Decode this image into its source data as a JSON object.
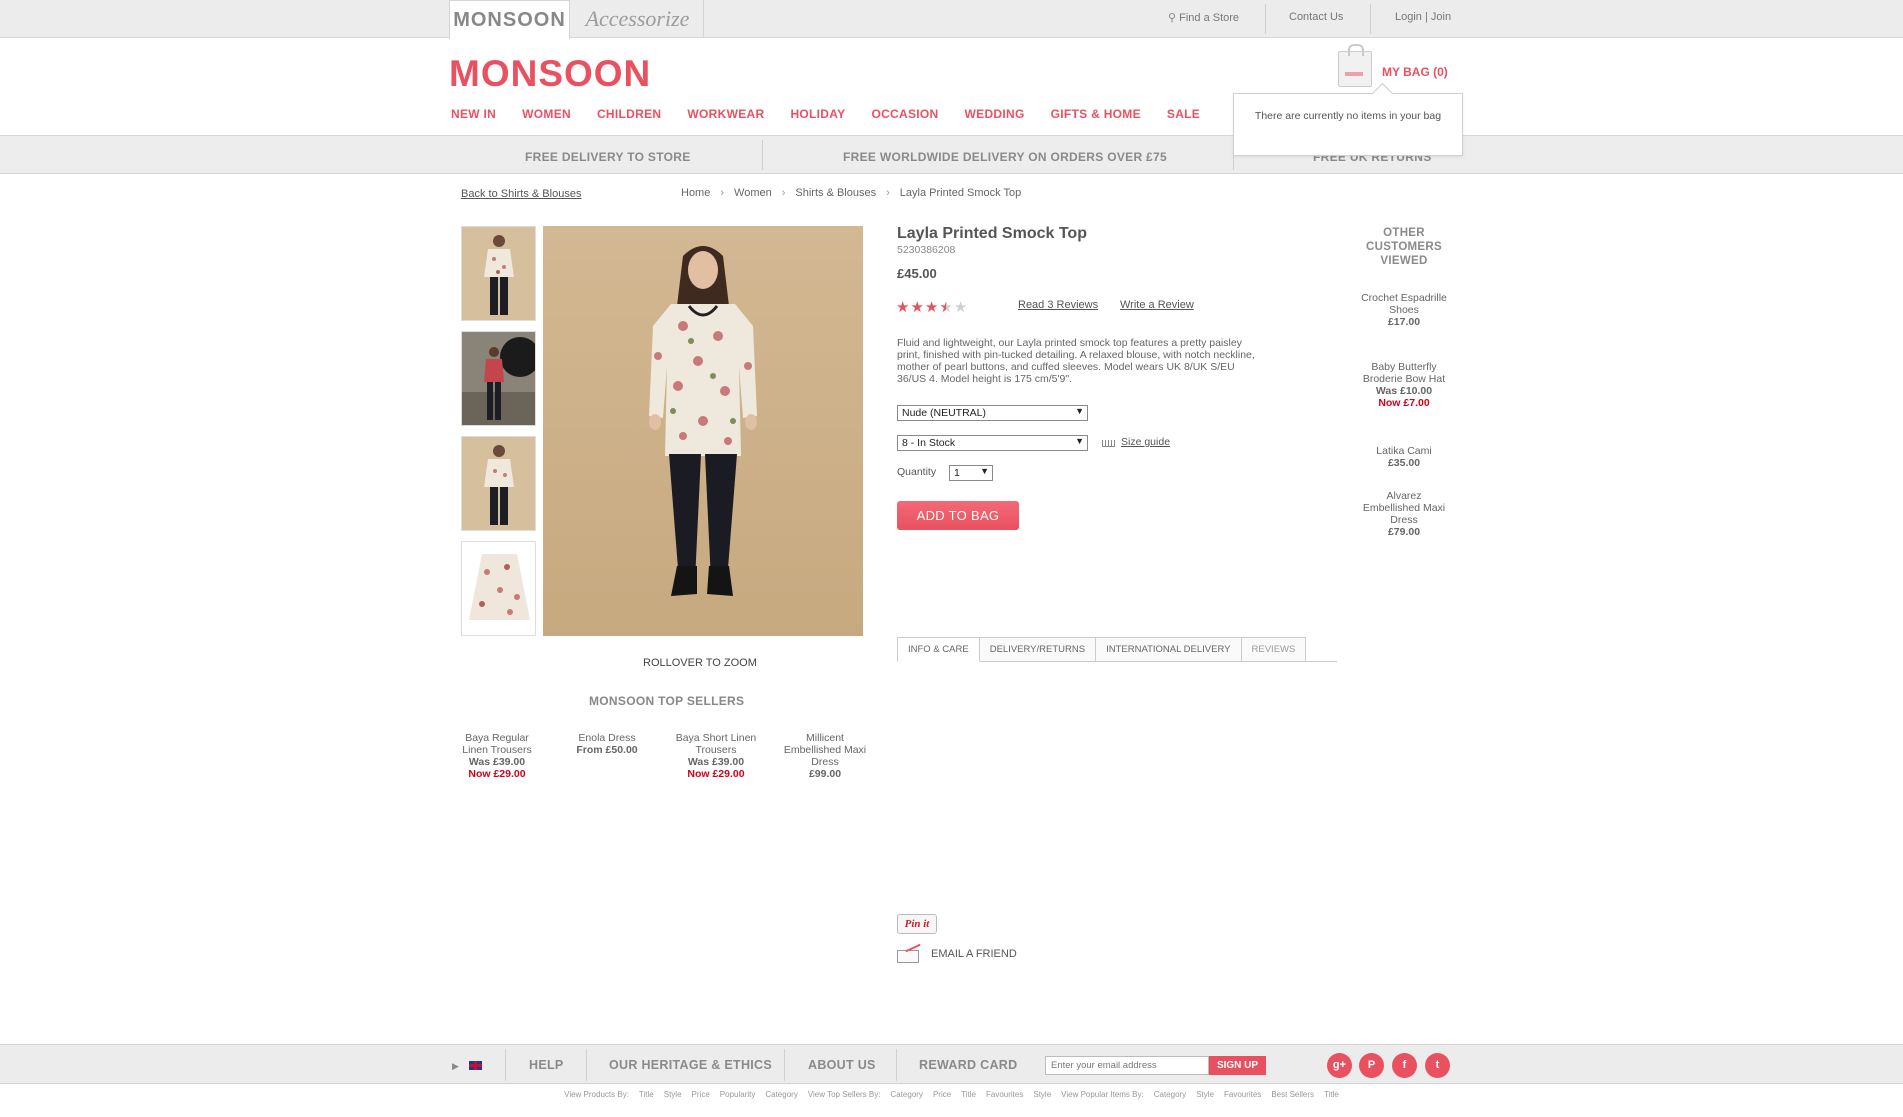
{
  "topbar": {
    "brand_monsoon": "MONSOON",
    "brand_accessorize": "Accessorize",
    "find_store": "Find a Store",
    "contact": "Contact Us",
    "login": "Login | Join"
  },
  "header": {
    "logo": "MONSOON",
    "bag": "MY BAG (0)",
    "bag_popup": "There are currently no items in your bag",
    "nav": [
      "NEW IN",
      "WOMEN",
      "CHILDREN",
      "WORKWEAR",
      "HOLIDAY",
      "OCCASION",
      "WEDDING",
      "GIFTS & HOME",
      "SALE"
    ]
  },
  "promo": {
    "left": "FREE DELIVERY TO STORE",
    "middle": "FREE WORLDWIDE DELIVERY ON ORDERS OVER £75",
    "right": "FREE UK RETURNS"
  },
  "breadcrumb": {
    "back": "Back to Shirts & Blouses",
    "items": [
      "Home",
      "Women",
      "Shirts & Blouses",
      "Layla Printed Smock Top"
    ]
  },
  "gallery": {
    "zoom": "ROLLOVER TO ZOOM"
  },
  "top_sellers": {
    "title": "MONSOON TOP SELLERS",
    "items": [
      {
        "name": "Baya Regular Linen Trousers",
        "was": "Was £39.00",
        "now": "Now £29.00"
      },
      {
        "name": "Enola Dress",
        "price": "From £50.00"
      },
      {
        "name": "Baya Short Linen Trousers",
        "was": "Was £39.00",
        "now": "Now £29.00"
      },
      {
        "name": "Millicent Embellished Maxi Dress",
        "price": "£99.00"
      }
    ]
  },
  "product": {
    "title": "Layla Printed Smock Top",
    "code": "5230386208",
    "price": "£45.00",
    "rating": 3.5,
    "rating_max": 5,
    "read_reviews": "Read 3 Reviews",
    "write_review": "Write a Review",
    "description": "Fluid and lightweight, our Layla printed smock top features a pretty paisley print, finished with pin-tucked detailing. A relaxed blouse, with notch neckline, mother of pearl buttons, and cuffed sleeves. Model wears UK 8/UK S/EU 36/US 4. Model height is 175 cm/5'9\".",
    "colour": "Nude (NEUTRAL)",
    "size": "8 - In Stock",
    "size_guide": "Size guide",
    "quantity_label": "Quantity",
    "quantity": "1",
    "add_to_bag": "ADD TO BAG",
    "tabs": [
      "INFO & CARE",
      "DELIVERY/RETURNS",
      "INTERNATIONAL DELIVERY",
      "REVIEWS"
    ],
    "pin": "Pin it",
    "email_friend": "EMAIL A FRIEND"
  },
  "other_viewed": {
    "title": "OTHER CUSTOMERS VIEWED",
    "items": [
      {
        "name": "Crochet Espadrille Shoes",
        "price": "£17.00"
      },
      {
        "name": "Baby Butterfly Broderie Bow Hat",
        "was": "Was £10.00",
        "now": "Now £7.00"
      },
      {
        "name": "Latika Cami",
        "price": "£35.00"
      },
      {
        "name": "Alvarez Embellished Maxi Dress",
        "price": "£79.00"
      }
    ]
  },
  "footer": {
    "help": "HELP",
    "heritage": "OUR HERITAGE & ETHICS",
    "about": "ABOUT US",
    "reward": "REWARD CARD",
    "email_placeholder": "Enter your email address",
    "signup": "SIGN UP",
    "social": [
      "g+",
      "P",
      "f",
      "t"
    ],
    "bottom_links": [
      "View Products By:",
      "Title",
      "Style",
      "Price",
      "Popularity",
      "Category",
      "View Top Sellers By:",
      "Category",
      "Price",
      "Title",
      "Favourites",
      "Style",
      "View Popular Items By:",
      "Category",
      "Style",
      "Favourites",
      "Best Sellers",
      "Title"
    ]
  },
  "colors": {
    "brand": "#ea5160",
    "sale": "#d0021b"
  }
}
